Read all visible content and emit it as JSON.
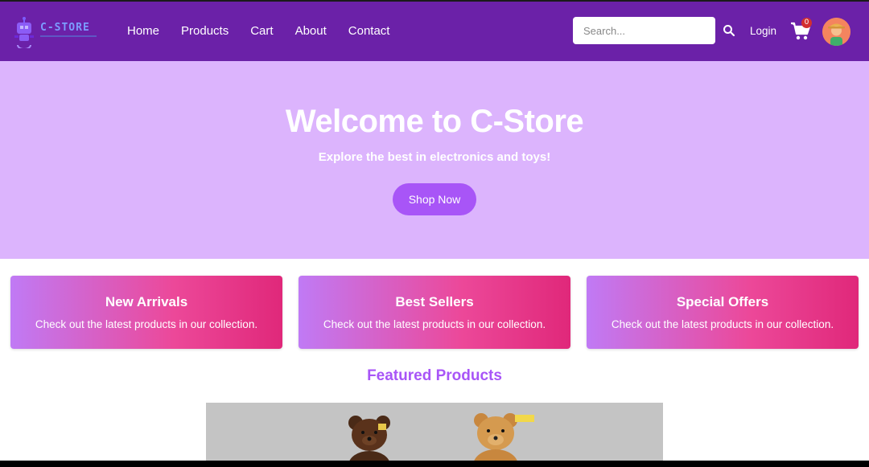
{
  "brand": {
    "name": "C-STORE"
  },
  "nav": {
    "links": [
      "Home",
      "Products",
      "Cart",
      "About",
      "Contact"
    ],
    "search_placeholder": "Search...",
    "login_label": "Login",
    "cart_count": "0"
  },
  "hero": {
    "title": "Welcome to C-Store",
    "subtitle": "Explore the best in electronics and toys!",
    "button_label": "Shop Now",
    "background": "#dcb4fd"
  },
  "cards": [
    {
      "title": "New Arrivals",
      "text": "Check out the latest products in our collection."
    },
    {
      "title": "Best Sellers",
      "text": "Check out the latest products in our collection."
    },
    {
      "title": "Special Offers",
      "text": "Check out the latest products in our collection."
    }
  ],
  "featured": {
    "heading": "Featured Products"
  },
  "colors": {
    "navbar": "#6b21a8",
    "accent": "#a855f7",
    "card_gradient_start": "#c07af5",
    "card_gradient_end": "#e0287a",
    "badge": "#d32f2f"
  },
  "icons": [
    "robot-logo-icon",
    "search-icon",
    "shopping-cart-icon",
    "avatar-image",
    "teddy-bear-image"
  ]
}
